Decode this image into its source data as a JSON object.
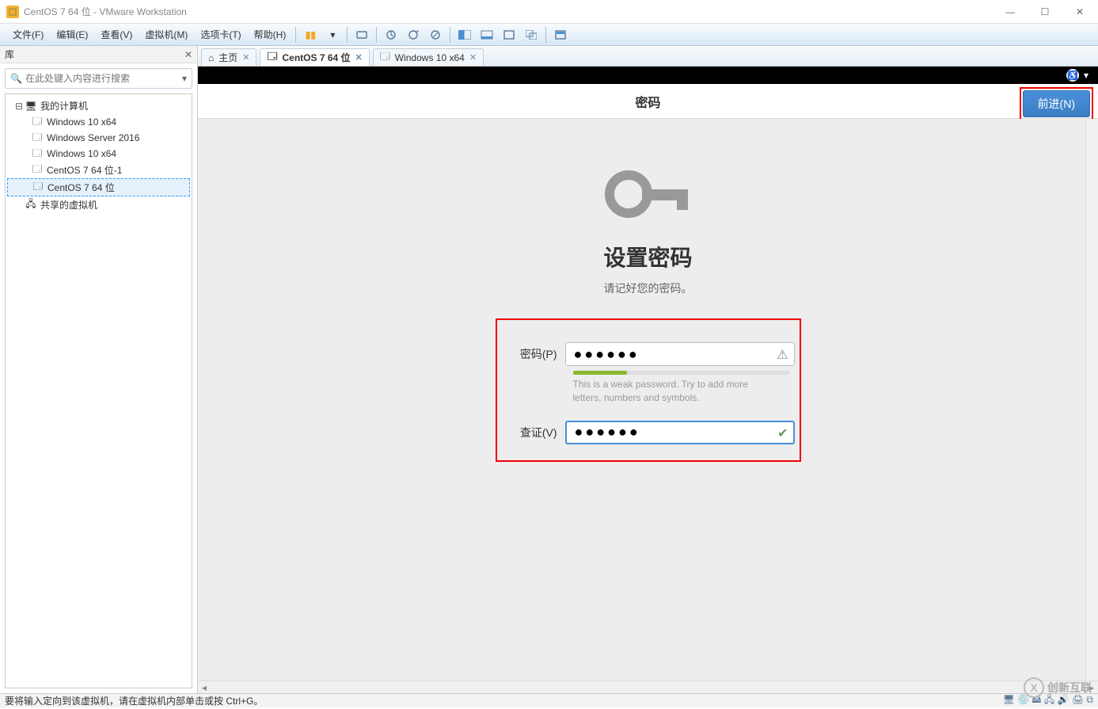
{
  "window": {
    "title": "CentOS 7 64 位 - VMware Workstation"
  },
  "menu": {
    "items": [
      "文件(F)",
      "编辑(E)",
      "查看(V)",
      "虚拟机(M)",
      "选项卡(T)",
      "帮助(H)"
    ]
  },
  "sidebar": {
    "header": "库",
    "search_placeholder": "在此处键入内容进行搜索",
    "root": "我的计算机",
    "items": [
      "Windows 10 x64",
      "Windows Server 2016",
      "Windows 10 x64",
      "CentOS 7 64 位-1",
      "CentOS 7 64 位"
    ],
    "shared": "共享的虚拟机"
  },
  "tabs": [
    {
      "label": "主页"
    },
    {
      "label": "CentOS 7 64 位",
      "active": true
    },
    {
      "label": "Windows 10 x64"
    }
  ],
  "vm": {
    "topbar_title": "密码",
    "next_button": "前进(N)",
    "heading": "设置密码",
    "subheading": "请记好您的密码。",
    "pw_label": "密码(P)",
    "confirm_label": "查证(V)",
    "pw_value": "●●●●●●",
    "confirm_value": "●●●●●●",
    "weak_text": "This is a weak password. Try to add more letters, numbers and symbols."
  },
  "statusbar": {
    "text": "要将输入定向到该虚拟机，请在虚拟机内部单击或按 Ctrl+G。"
  },
  "watermark": "创新互联"
}
